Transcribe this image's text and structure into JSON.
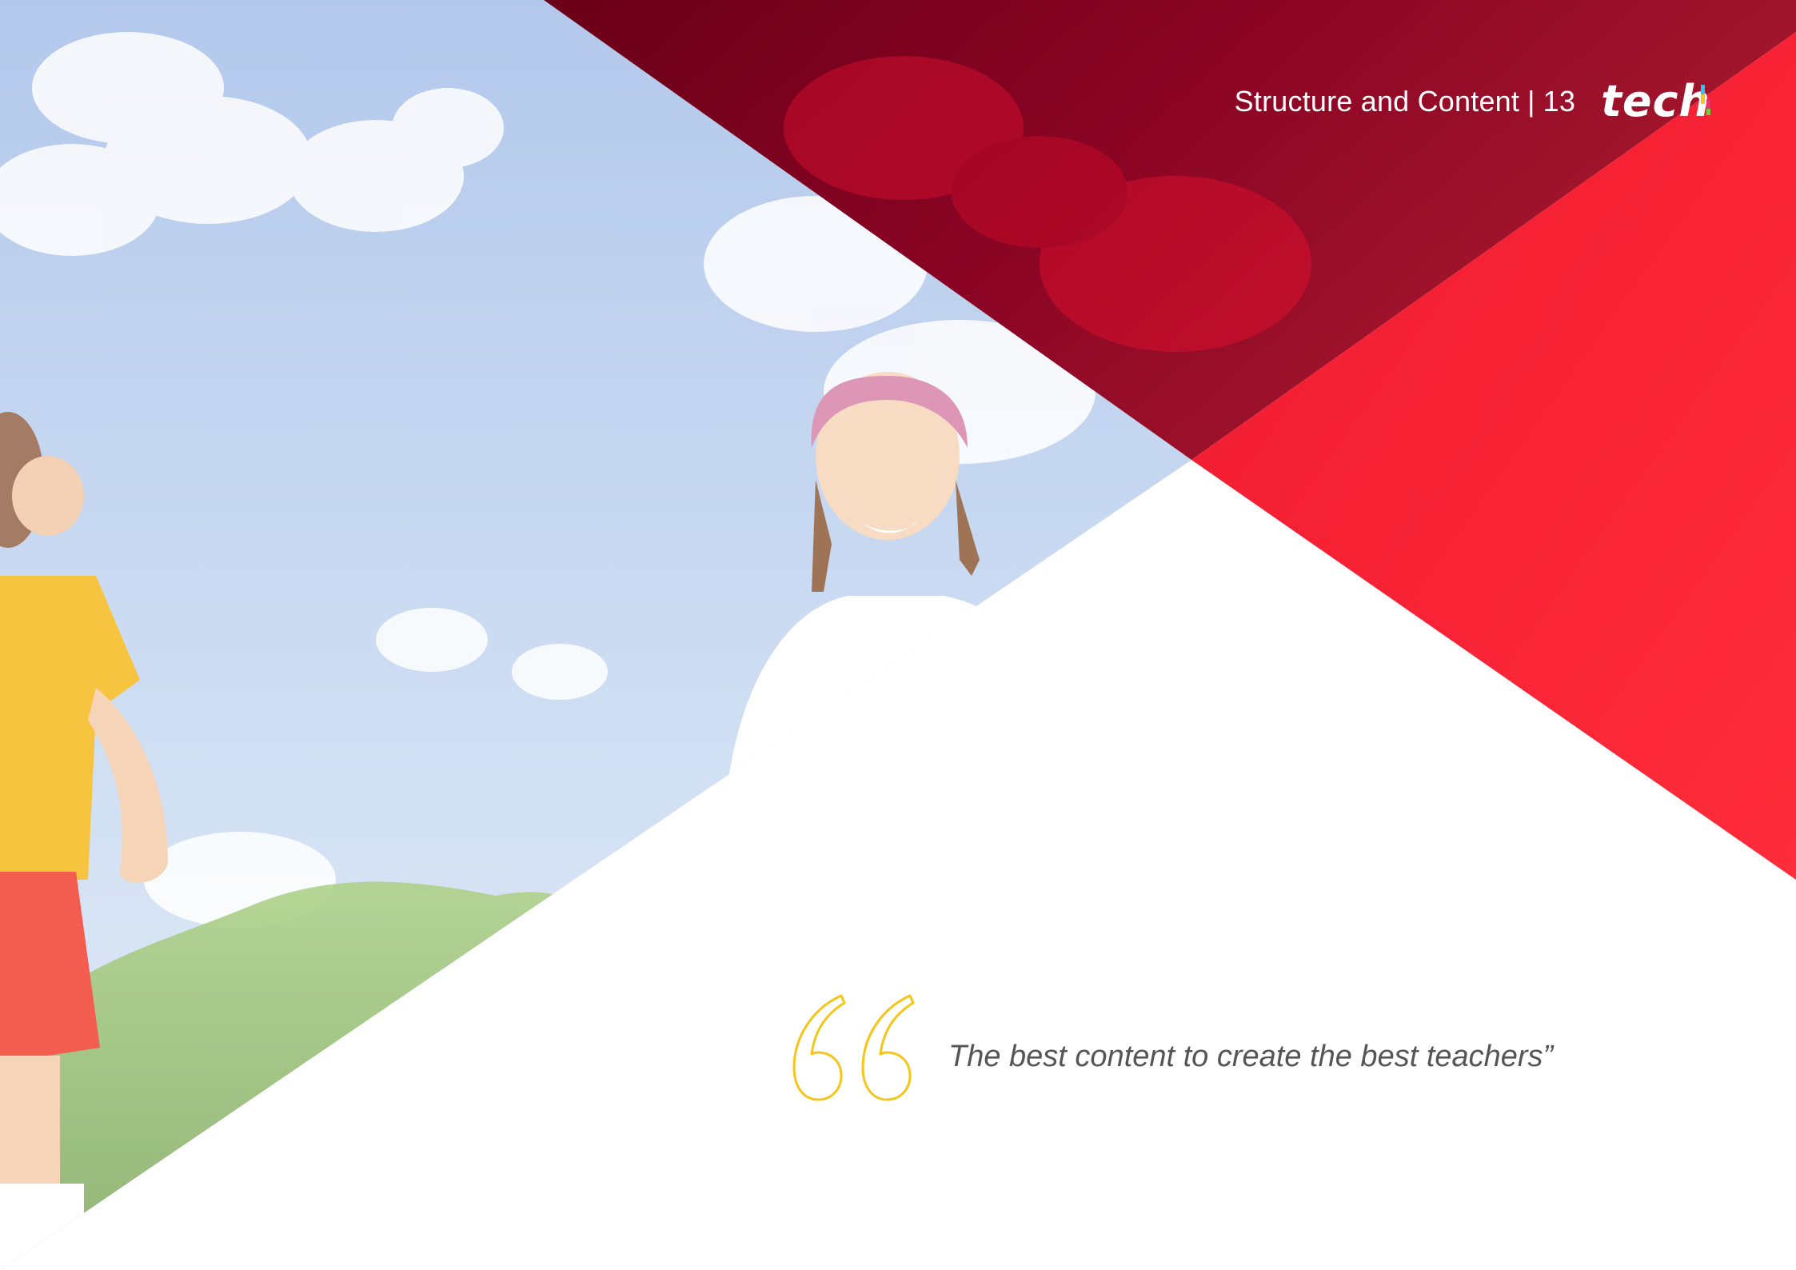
{
  "header": {
    "section_title": "Structure and Content",
    "separator": "|",
    "page_number": "13",
    "logo_text": "tech"
  },
  "quote": {
    "text": "The best content to create the best teachers”",
    "mark_color": "#f5c518"
  },
  "colors": {
    "dark_red": "#7a0020",
    "bright_red": "#ff2a38",
    "sky": "#a9c3ea",
    "quote_text": "#555555"
  },
  "icons": {
    "quote_mark": "double-open-quote-outline",
    "logo": "tech-logo"
  }
}
